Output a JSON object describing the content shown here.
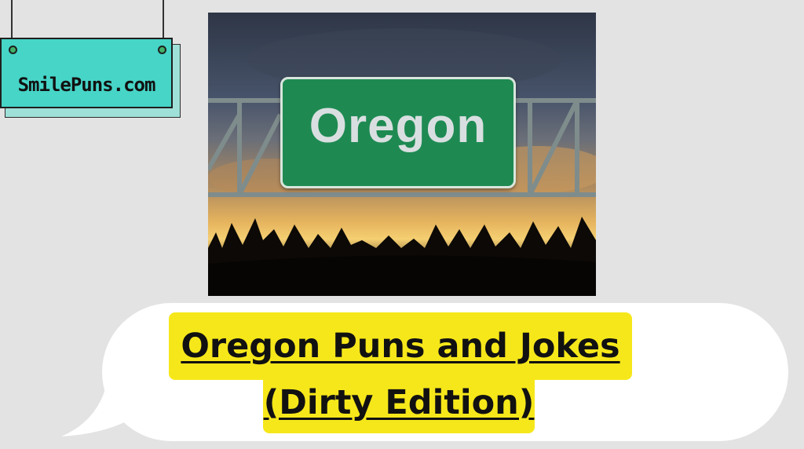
{
  "site_sign": {
    "label": "SmilePuns.com"
  },
  "photo": {
    "road_sign_text": "Oregon"
  },
  "headline": {
    "line1": "Oregon Puns and Jokes",
    "line2": "(Dirty Edition)"
  },
  "colors": {
    "background": "#e3e3e3",
    "sign_teal": "#46d5c7",
    "highlight_yellow": "#f6e71a",
    "road_sign_green": "#1e8a52"
  }
}
